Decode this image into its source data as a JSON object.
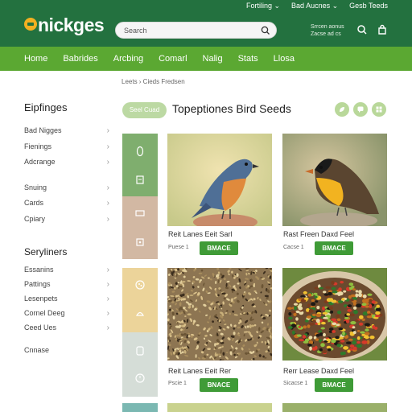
{
  "header": {
    "logo": "nickges",
    "top_links": [
      "Fortiling ⌄",
      "Bad Aucnes ⌄",
      "Gesb Teeds"
    ],
    "search_placeholder": "Search",
    "promo": "Srrcen aonus\nZacse ad cs",
    "colors": {
      "header": "#23713f",
      "nav": "#5ba832",
      "button": "#3f9b37",
      "accent": "#f2b021"
    }
  },
  "nav": [
    "Home",
    "Babrides",
    "Arcbing",
    "Comarl",
    "Nalig",
    "Stats",
    "Llosa"
  ],
  "breadcrumb": "Leets  ›  Cieds Fredsen",
  "sidebar": {
    "title": "Eipfinges",
    "group1": [
      "Bad Nigges",
      "Fienings",
      "Adcrange"
    ],
    "group2": [
      "Snuing",
      "Cards",
      "Cpiary"
    ],
    "title2": "Seryliners",
    "group3": [
      "Essanins",
      "Pattings",
      "Lesenpets",
      "Cornel Deeg",
      "Ceed Ues"
    ],
    "plain": "Cnnase"
  },
  "page": {
    "tag": "Seel Cuad",
    "title": "Topeptiones Bird Seeds",
    "action_icons": [
      "leaf-icon",
      "chat-icon",
      "grid-icon"
    ]
  },
  "products": [
    {
      "name": "Reit Lanes Eeit Sarl",
      "price": "Puese 1",
      "button": "BMACE"
    },
    {
      "name": "Rast Freen Daxd Feel",
      "price": "Cacse 1",
      "button": "BMACE"
    },
    {
      "name": "Reit Lanes Eeit Rer",
      "price": "Pscie 1",
      "button": "BNACE"
    },
    {
      "name": "Rerr Lease Daxd Feel",
      "price": "Sicacse 1",
      "button": "BMACE"
    }
  ]
}
